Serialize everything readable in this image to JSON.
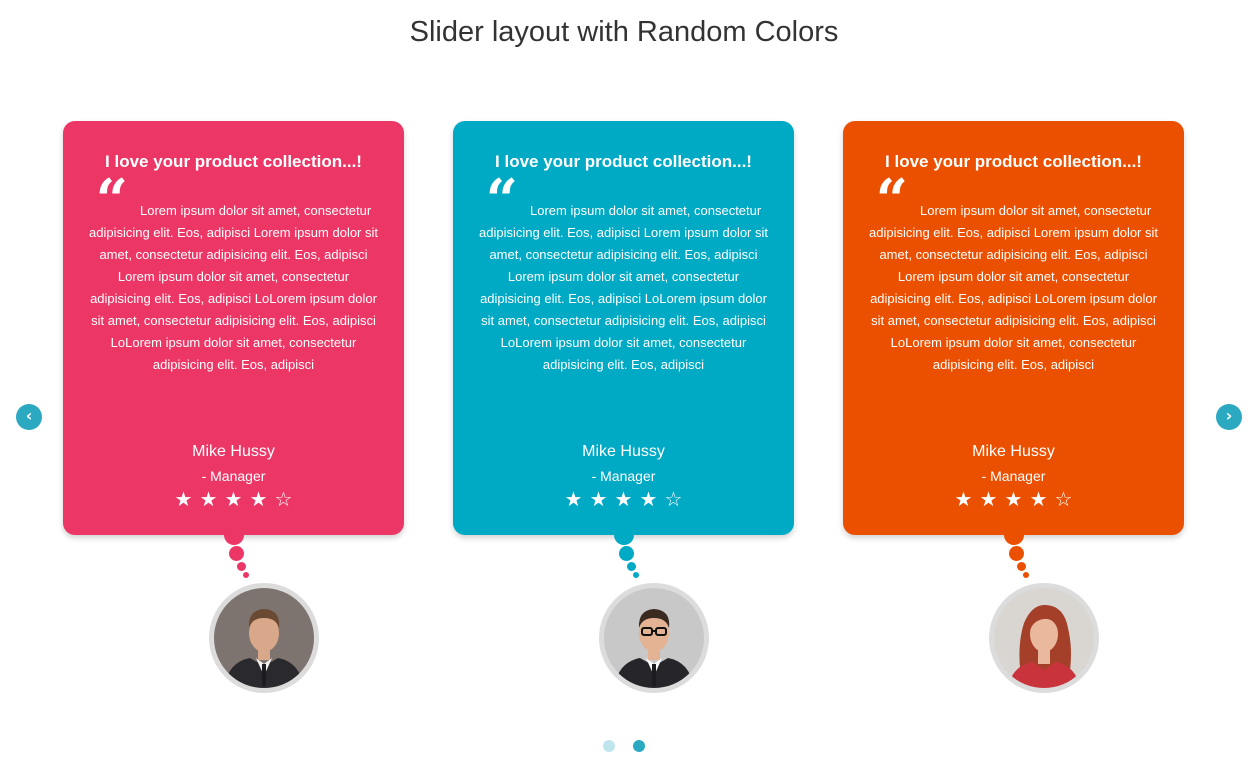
{
  "page": {
    "title": "Slider layout with Random Colors"
  },
  "nav": {
    "prev_icon": "chevron-left-icon",
    "next_icon": "chevron-right-icon",
    "prev_glyph": "‹",
    "next_glyph": "›",
    "accent": "#2aa9c1"
  },
  "cards": [
    {
      "title": "I love your product collection...!",
      "quote_glyph": "“",
      "text": "Lorem ipsum dolor sit amet, consectetur adipisicing elit. Eos, adipisci Lorem ipsum dolor sit amet, consectetur adipisicing elit. Eos, adipisci Lorem ipsum dolor sit amet, consectetur adipisicing elit. Eos, adipisci LoLorem ipsum dolor sit amet, consectetur adipisicing elit. Eos, adipisci LoLorem ipsum dolor sit amet, consectetur adipisicing elit. Eos, adipisci",
      "name": "Mike Hussy",
      "role": "- Manager",
      "rating": 4,
      "rating_max": 5,
      "color": "#ec3766"
    },
    {
      "title": "I love your product collection...!",
      "quote_glyph": "“",
      "text": "Lorem ipsum dolor sit amet, consectetur adipisicing elit. Eos, adipisci Lorem ipsum dolor sit amet, consectetur adipisicing elit. Eos, adipisci Lorem ipsum dolor sit amet, consectetur adipisicing elit. Eos, adipisci LoLorem ipsum dolor sit amet, consectetur adipisicing elit. Eos, adipisci LoLorem ipsum dolor sit amet, consectetur adipisicing elit. Eos, adipisci",
      "name": "Mike Hussy",
      "role": "- Manager",
      "rating": 4,
      "rating_max": 5,
      "color": "#00a9c4"
    },
    {
      "title": "I love your product collection...!",
      "quote_glyph": "“",
      "text": "Lorem ipsum dolor sit amet, consectetur adipisicing elit. Eos, adipisci Lorem ipsum dolor sit amet, consectetur adipisicing elit. Eos, adipisci Lorem ipsum dolor sit amet, consectetur adipisicing elit. Eos, adipisci LoLorem ipsum dolor sit amet, consectetur adipisicing elit. Eos, adipisci LoLorem ipsum dolor sit amet, consectetur adipisicing elit. Eos, adipisci",
      "name": "Mike Hussy",
      "role": "- Manager",
      "rating": 4,
      "rating_max": 5,
      "color": "#eb5000"
    }
  ],
  "stars": {
    "filled_glyph": "★",
    "empty_glyph": "☆"
  },
  "pagination": {
    "pages": 2,
    "active_index": 1,
    "active_color": "#2aa9c1",
    "inactive_color": "#bfe6ee"
  },
  "avatars": [
    {
      "icon": "man-in-suit-photo",
      "bg": "#7d7470",
      "skin": "#d9a88a",
      "hair": "#6a4a32",
      "suit": "#2a2a2e",
      "shirt": "#f2f2f2",
      "glasses": false
    },
    {
      "icon": "man-with-glasses-photo",
      "bg": "#c8c8c8",
      "skin": "#e3b394",
      "hair": "#3a2a20",
      "suit": "#26262a",
      "shirt": "#ffffff",
      "glasses": true
    },
    {
      "icon": "woman-red-hair-photo",
      "bg": "#d9d6d2",
      "skin": "#eab89d",
      "hair": "#a4402a",
      "suit": "#c9343c",
      "shirt": "#e9a489",
      "glasses": false
    }
  ]
}
